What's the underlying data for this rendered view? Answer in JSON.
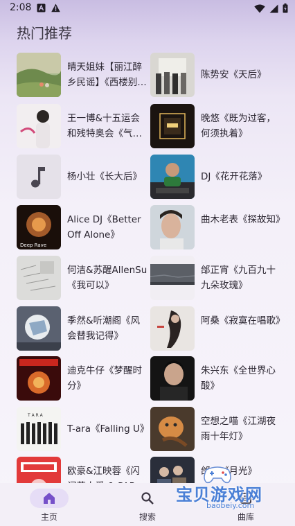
{
  "status_bar": {
    "time": "2:08"
  },
  "section": {
    "title": "热门推荐"
  },
  "songs": [
    {
      "label": "晴天姐妹【丽江醉乡民谣】《西楼别序》"
    },
    {
      "label": "陈势安《天后》"
    },
    {
      "label": "王一博&十五运会和残特奥会《气象万千》"
    },
    {
      "label": "晚悠《既为过客，何须执着》"
    },
    {
      "label": "杨小壮《长大后》"
    },
    {
      "label": "DJ《花开花落》"
    },
    {
      "label": "Alice DJ《Better Off Alone》"
    },
    {
      "label": "曲木老表《探故知》"
    },
    {
      "label": "何洁&苏醒AllenSu《我可以》"
    },
    {
      "label": "邰正宵《九百九十九朵玫瑰》"
    },
    {
      "label": "季然&听潮阁《风会替我记得》"
    },
    {
      "label": "阿桑《寂寞在唱歌》"
    },
    {
      "label": "迪克牛仔《梦醒时分》"
    },
    {
      "label": "朱兴东《全世界心酸》"
    },
    {
      "label": "T-ara《Falling U》"
    },
    {
      "label": "空想之喵《江湖夜雨十年灯》"
    },
    {
      "label": "欧豪&江映蓉《闪闪惹人爱 & PARTY》"
    },
    {
      "label": "邰…《月光》"
    }
  ],
  "cover_text": {
    "deep_rave": "Deep Rave",
    "tiara": "T A R A"
  },
  "bottom_nav": {
    "home": "主页",
    "search": "搜索",
    "library": "曲库"
  },
  "watermark": {
    "main": "宝贝游戏网",
    "url": "baobeiy.com"
  },
  "colors": {
    "accent": "#7650c9",
    "nav_pill": "#e6ddf6"
  }
}
